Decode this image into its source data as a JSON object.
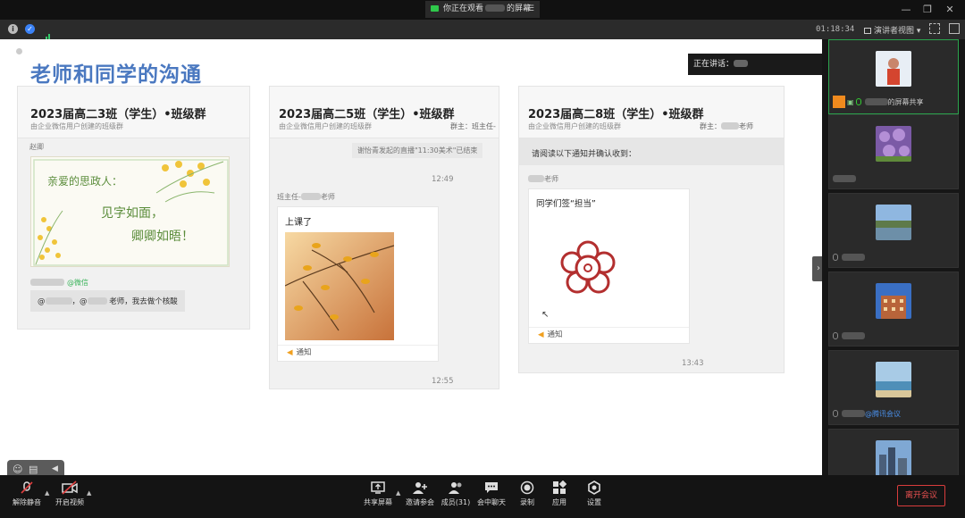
{
  "titlebar": {
    "sharing_text_prefix": "你正在观看",
    "sharing_text_suffix": "的屏幕",
    "menu_icon": "hamburger-icon",
    "window_controls": [
      "—",
      "❐",
      "✕"
    ]
  },
  "statusbar": {
    "timer": "01:18:34",
    "view_mode": "演讲者视图 ▾"
  },
  "slide": {
    "title": "老师和同学的沟通"
  },
  "cards": [
    {
      "group_name": "2023届高二3班（学生）•班级群",
      "subtitle": "由企业微信用户创建的班级群",
      "sender": "赵卿",
      "poster_line1": "亲爱的思政人：",
      "poster_line2": "见字如面，",
      "poster_line3": "卿卿如晤！",
      "wechat_tag": "@微信",
      "message": "老师，我去做个核酸"
    },
    {
      "group_name": "2023届高二5班（学生）•班级群",
      "subtitle": "由企业微信用户创建的班级群",
      "owner": "群主：班主任-",
      "system_msg": "谢怡青发起的直播\"11:30美术\"已结束",
      "time1": "12:49",
      "sender": "班主任-",
      "sender_suffix": "老师",
      "message": "上课了",
      "notice": "通知",
      "time2": "12:55"
    },
    {
      "group_name": "2023届高二8班（学生）•班级群",
      "subtitle": "由企业微信用户创建的班级群",
      "owner": "群主：",
      "owner_suffix": "老师",
      "top_msg": "请阅读以下通知并确认收到：",
      "sender_suffix": "老师",
      "message": "同学们签“担当”",
      "notice": "通知",
      "time": "13:43"
    }
  ],
  "speaking": {
    "label": "正在讲话："
  },
  "participants": [
    {
      "name_suffix": "的屏幕共享",
      "thumb": "person-photo",
      "active": true
    },
    {
      "name_suffix": "",
      "thumb": "hydrangea-flowers"
    },
    {
      "name_suffix": "",
      "thumb": "lake-landscape"
    },
    {
      "name_suffix": "",
      "thumb": "building-photo"
    },
    {
      "name_suffix": "@腾讯会议",
      "thumb": "beach-photo"
    },
    {
      "name_suffix": "",
      "thumb": "cityscape-photo"
    }
  ],
  "toolbar": {
    "unmute": "解除静音",
    "start_video": "开启视频",
    "share_screen": "共享屏幕",
    "invite": "邀请参会",
    "members": "成员(31)",
    "chat": "会中聊天",
    "record": "录制",
    "apps": "应用",
    "settings": "设置",
    "leave": "离开会议"
  },
  "colors": {
    "title_blue": "#4a78c0",
    "active_green": "#2ba44d",
    "leave_red": "#e85050"
  }
}
